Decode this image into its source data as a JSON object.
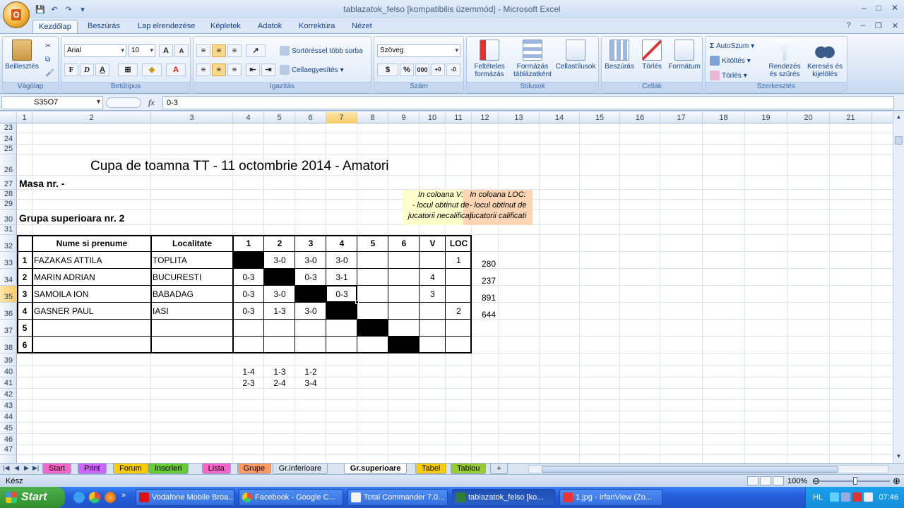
{
  "window": {
    "title": "tablazatok_felso  [kompatibilis üzemmód] - Microsoft Excel",
    "controls": [
      "–",
      "□",
      "✕"
    ]
  },
  "ribbon_tabs": [
    "Kezdőlap",
    "Beszúrás",
    "Lap elrendezése",
    "Képletek",
    "Adatok",
    "Korrektúra",
    "Nézet"
  ],
  "ribbon": {
    "clipboard": {
      "paste": "Beillesztés",
      "label": "Vágólap"
    },
    "font": {
      "name": "Arial",
      "size": "10",
      "bold": "F",
      "italic": "D",
      "underline": "A",
      "label": "Betűtípus"
    },
    "alignment": {
      "wrap": "Sortöréssel több sorba",
      "merge": "Cellaegyesítés",
      "label": "Igazítás"
    },
    "number": {
      "format": "Szöveg",
      "percent": "%",
      "thousands": "000",
      "label": "Szám"
    },
    "styles": {
      "conditional": "Feltételes formázás",
      "table": "Formázás táblázatként",
      "cell": "Cellastílusok",
      "label": "Stílusok"
    },
    "cells": {
      "insert": "Beszúrás",
      "delete": "Törlés",
      "format": "Formátum",
      "label": "Cellák"
    },
    "editing": {
      "autosum": "AutoSzum",
      "fill": "Kitöltés",
      "clear": "Törlés",
      "sort": "Rendezés és szűrés",
      "find": "Keresés és kijelölés",
      "label": "Szerkesztés"
    }
  },
  "formula_bar": {
    "name_box": "S35O7",
    "fx": "fx",
    "content": "0-3"
  },
  "columns": [
    "1",
    "2",
    "3",
    "4",
    "5",
    "6",
    "7",
    "8",
    "9",
    "10",
    "11",
    "12",
    "13",
    "14",
    "15",
    "16",
    "17",
    "18",
    "19",
    "20",
    "21"
  ],
  "rows": [
    "23",
    "24",
    "25",
    "26",
    "27",
    "28",
    "29",
    "30",
    "31",
    "32",
    "33",
    "34",
    "35",
    "36",
    "37",
    "38",
    "39",
    "40",
    "41",
    "42",
    "43",
    "44",
    "45",
    "46",
    "47"
  ],
  "sheet": {
    "title": "Cupa de toamna TT - 11 octombrie 2014 - Amatori",
    "masa": "Masa nr.  -",
    "grupa": "Grupa superioara nr. 2",
    "note_v": [
      "In coloana V:",
      "- locul obtinut de",
      "jucatorii necalificati"
    ],
    "note_loc": [
      "In coloana LOC:",
      "- locul obtinut de",
      "jucatorii calificati"
    ],
    "table_headers": [
      "Nume si prenume",
      "Localitate",
      "1",
      "2",
      "3",
      "4",
      "5",
      "6",
      "V",
      "LOC"
    ],
    "players": [
      {
        "no": "1",
        "name": "FAZAKAS ATTILA",
        "city": "TOPLITA",
        "r": [
          "",
          "3-0",
          "3-0",
          "3-0",
          "",
          ""
        ],
        "v": "",
        "loc": "1",
        "extra": "280"
      },
      {
        "no": "2",
        "name": "MARIN ADRIAN",
        "city": "BUCURESTI",
        "r": [
          "0-3",
          "",
          "0-3",
          "3-1",
          "",
          ""
        ],
        "v": "4",
        "loc": "",
        "extra": "237"
      },
      {
        "no": "3",
        "name": "SAMOILA ION",
        "city": "BABADAG",
        "r": [
          "0-3",
          "3-0",
          "",
          "0-3",
          "",
          ""
        ],
        "v": "3",
        "loc": "",
        "extra": "891"
      },
      {
        "no": "4",
        "name": "GASNER PAUL",
        "city": "IASI",
        "r": [
          "0-3",
          "1-3",
          "3-0",
          "",
          "",
          ""
        ],
        "v": "",
        "loc": "2",
        "extra": "644"
      },
      {
        "no": "5",
        "name": "",
        "city": "",
        "r": [
          "",
          "",
          "",
          "",
          "",
          ""
        ],
        "v": "",
        "loc": "",
        "extra": ""
      },
      {
        "no": "6",
        "name": "",
        "city": "",
        "r": [
          "",
          "",
          "",
          "",
          "",
          ""
        ],
        "v": "",
        "loc": "",
        "extra": ""
      }
    ],
    "pairings": [
      [
        "1-4",
        "1-3",
        "1-2"
      ],
      [
        "2-3",
        "2-4",
        "3-4"
      ]
    ]
  },
  "sheet_tabs": [
    {
      "name": "Start",
      "color": "#ff66cc"
    },
    {
      "name": "Print",
      "color": "#cc66ff"
    },
    {
      "name": "Forum",
      "color": "#ffcc00"
    },
    {
      "name": "Inscrieri",
      "color": "#66cc33"
    },
    {
      "name": "Lista",
      "color": "#ff66cc"
    },
    {
      "name": "Grupe",
      "color": "#ff9966"
    },
    {
      "name": "Gr.inferioare",
      "color": "#dbe5f2"
    },
    {
      "name": "Gr.superioare",
      "color": "#ffffff"
    },
    {
      "name": "Tabel",
      "color": "#ffcc00"
    },
    {
      "name": "Tablou",
      "color": "#99cc33"
    }
  ],
  "status": {
    "ready": "Kész",
    "zoom": "100%"
  },
  "taskbar": {
    "start": "Start",
    "tasks": [
      "Vodafone Mobile Broa...",
      "Facebook - Google C...",
      "Total Commander 7.0...",
      "tablazatok_felso  [ko...",
      "1.jpg - IrfanView (Zo..."
    ],
    "lang": "HL",
    "clock": "07:46"
  }
}
